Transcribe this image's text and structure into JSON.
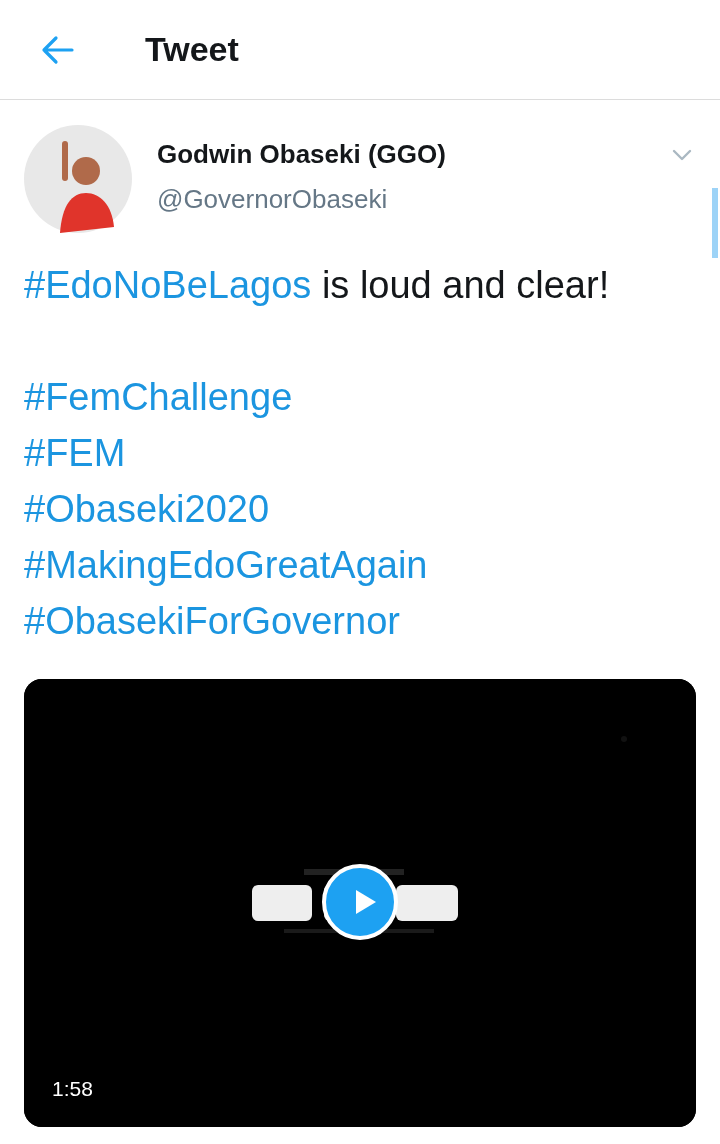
{
  "header": {
    "title": "Tweet"
  },
  "tweet": {
    "author_name": "Godwin Obaseki (GGO)",
    "handle": "@GovernorObaseki",
    "paragraphs": [
      [
        [
          {
            "kind": "hashtag",
            "text": "#EdoNoBeLagos"
          },
          {
            "kind": "text",
            "text": " is loud and clear!"
          }
        ]
      ],
      [
        [
          {
            "kind": "hashtag",
            "text": "#FemChallenge"
          }
        ],
        [
          {
            "kind": "hashtag",
            "text": "#FEM"
          }
        ],
        [
          {
            "kind": "hashtag",
            "text": "#Obaseki2020"
          }
        ],
        [
          {
            "kind": "hashtag",
            "text": "#MakingEdoGreatAgain"
          }
        ],
        [
          {
            "kind": "hashtag",
            "text": "#ObasekiForGovernor"
          }
        ]
      ]
    ],
    "media": {
      "kind": "video",
      "duration": "1:58"
    }
  }
}
